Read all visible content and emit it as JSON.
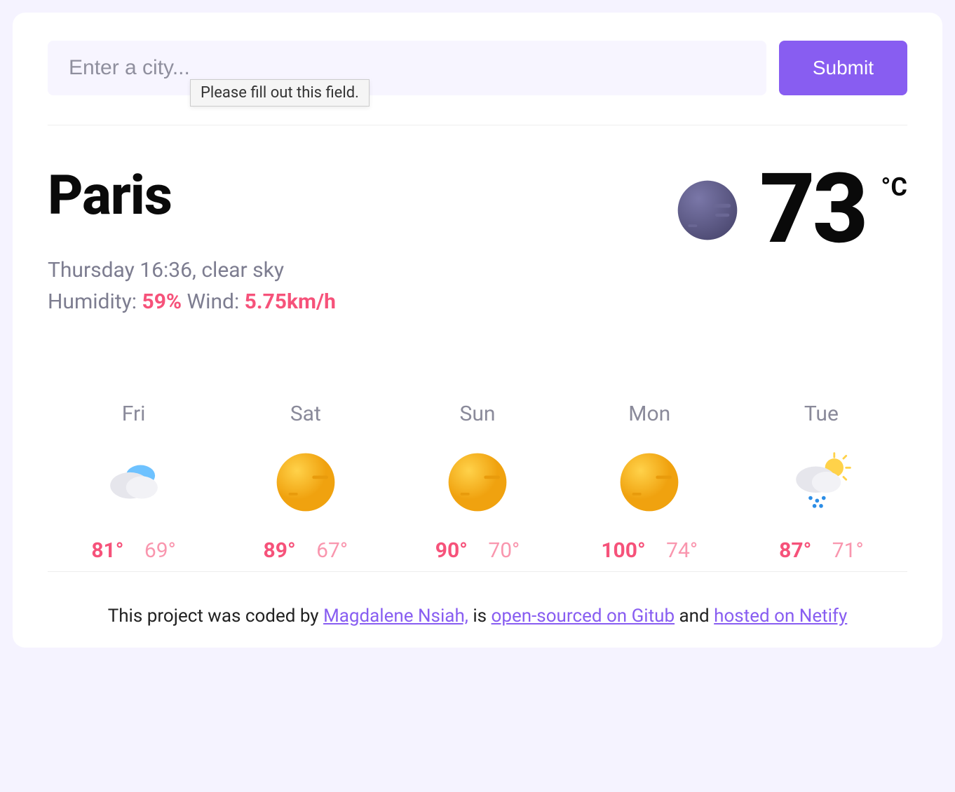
{
  "search": {
    "placeholder": "Enter a city...",
    "submit_label": "Submit",
    "validation_tooltip": "Please fill out this field."
  },
  "current": {
    "city": "Paris",
    "datetime_condition": "Thursday 16:36, clear sky",
    "humidity_label": "Humidity:",
    "humidity_value": "59%",
    "wind_label": "Wind:",
    "wind_value": "5.75km/h",
    "temperature": "73",
    "unit": "°C",
    "icon": "night-clear"
  },
  "forecast": [
    {
      "day": "Fri",
      "icon": "cloudy",
      "hi": "81°",
      "lo": "69°"
    },
    {
      "day": "Sat",
      "icon": "sunny",
      "hi": "89°",
      "lo": "67°"
    },
    {
      "day": "Sun",
      "icon": "sunny",
      "hi": "90°",
      "lo": "70°"
    },
    {
      "day": "Mon",
      "icon": "sunny",
      "hi": "100°",
      "lo": "74°"
    },
    {
      "day": "Tue",
      "icon": "rain-sun",
      "hi": "87°",
      "lo": "71°"
    }
  ],
  "footer": {
    "pre": "This project was coded by ",
    "author": "Magdalene Nsiah,",
    "mid1": " is ",
    "link1": "open-sourced on Gitub",
    "mid2": " and ",
    "link2": "hosted on Netify"
  }
}
